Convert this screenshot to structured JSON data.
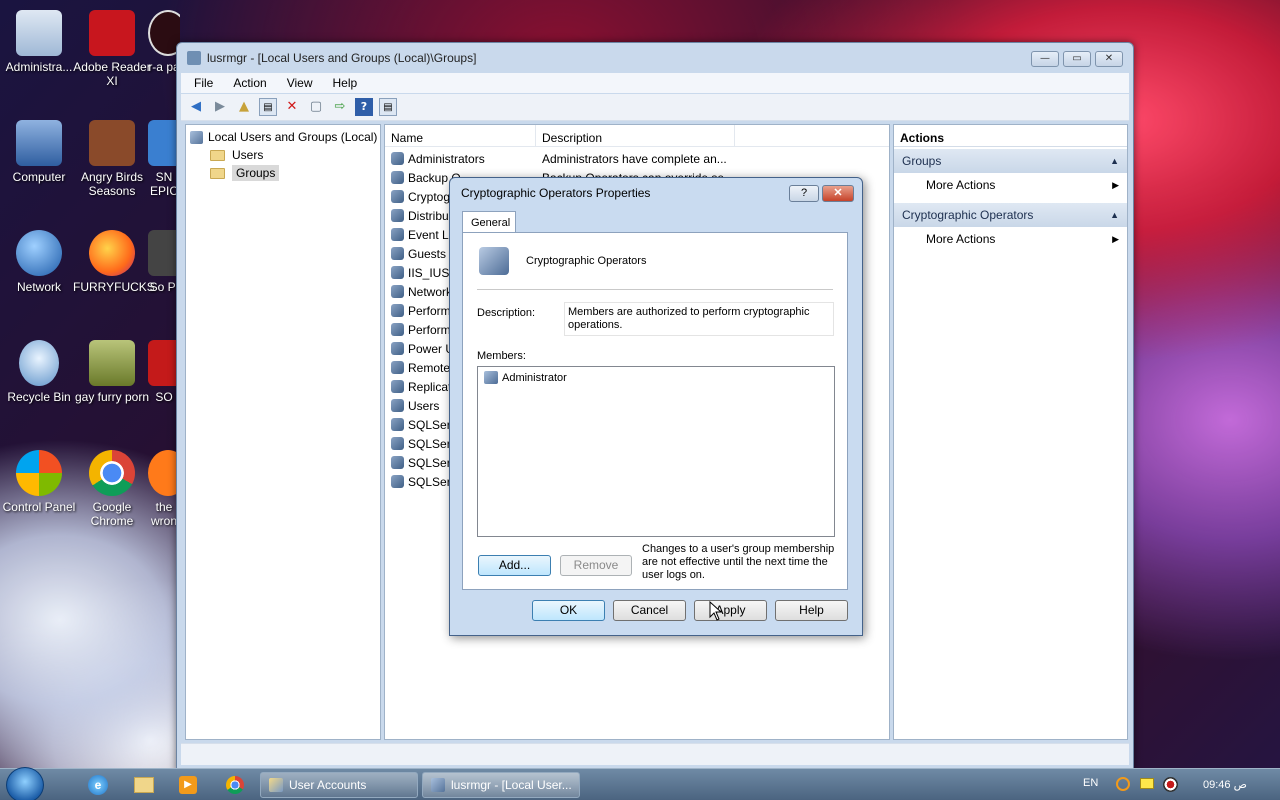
{
  "desktop": {
    "icons": [
      {
        "label": "Administra...",
        "color": "#9fb8d6"
      },
      {
        "label": "Adobe Reader XI",
        "color": "#c8161e"
      },
      {
        "label": "r-a pa",
        "color": "#2b0c12"
      },
      {
        "label": "Computer",
        "color": "#5d86c2"
      },
      {
        "label": "Angry Birds Seasons",
        "color": "#8a4a2a"
      },
      {
        "label": "SN EPIC",
        "color": "#3a7fd0"
      },
      {
        "label": "Network",
        "color": "#2c6cc0"
      },
      {
        "label": "FURRYFUCKS",
        "color": "#ff7a1a"
      },
      {
        "label": "So Pl",
        "color": "#444444"
      },
      {
        "label": "Recycle Bin",
        "color": "#8fb4d8"
      },
      {
        "label": "gay furry porn",
        "color": "#7a9a3a"
      },
      {
        "label": "SO",
        "color": "#c41a1a"
      },
      {
        "label": "Control Panel",
        "color": "#3b6fa8"
      },
      {
        "label": "Google Chrome",
        "color": "#e8b321"
      },
      {
        "label": "the wron",
        "color": "#ff7a1a"
      }
    ]
  },
  "window": {
    "title": "lusrmgr - [Local Users and Groups (Local)\\Groups]",
    "controls": {
      "minimize": "—",
      "maximize": "▭",
      "close": "✕"
    }
  },
  "menu": [
    "File",
    "Action",
    "View",
    "Help"
  ],
  "toolbar": {
    "icons": [
      "back-icon",
      "forward-icon",
      "up-icon",
      "show-hide-tree-icon",
      "delete-icon",
      "properties-icon",
      "export-icon",
      "help-icon",
      "show-hide-action-icon"
    ]
  },
  "tree": {
    "root": "Local Users and Groups (Local)",
    "children": [
      "Users",
      "Groups"
    ],
    "selected": "Groups"
  },
  "list": {
    "columns": [
      "Name",
      "Description"
    ],
    "rows": [
      {
        "name": "Administrators",
        "desc": "Administrators have complete an..."
      },
      {
        "name": "Backup O",
        "desc": "Backup Operators can override se..."
      },
      {
        "name": "Cryptog",
        "desc": ""
      },
      {
        "name": "Distribu",
        "desc": ""
      },
      {
        "name": "Event Lo",
        "desc": ""
      },
      {
        "name": "Guests",
        "desc": ""
      },
      {
        "name": "IIS_IUSR",
        "desc": ""
      },
      {
        "name": "Network",
        "desc": ""
      },
      {
        "name": "Perform",
        "desc": ""
      },
      {
        "name": "Perform",
        "desc": ""
      },
      {
        "name": "Power U",
        "desc": ""
      },
      {
        "name": "Remote",
        "desc": ""
      },
      {
        "name": "Replicat",
        "desc": ""
      },
      {
        "name": "Users",
        "desc": ""
      },
      {
        "name": "SQLServ",
        "desc": ""
      },
      {
        "name": "SQLServ",
        "desc": ""
      },
      {
        "name": "SQLServ",
        "desc": ""
      },
      {
        "name": "SQLServ",
        "desc": ""
      }
    ]
  },
  "actions": {
    "header": "Actions",
    "sections": [
      {
        "title": "Groups",
        "item": "More Actions"
      },
      {
        "title": "Cryptographic Operators",
        "item": "More Actions"
      }
    ]
  },
  "dialog": {
    "title": "Cryptographic Operators Properties",
    "help_btn": "?",
    "close_btn": "✕",
    "tab": "General",
    "group_name": "Cryptographic Operators",
    "description_label": "Description:",
    "description": "Members are authorized to perform cryptographic operations.",
    "members_label": "Members:",
    "members": [
      "Administrator"
    ],
    "add": "Add...",
    "remove": "Remove",
    "note": "Changes to a user's group membership are not effective until the next time the user logs on.",
    "ok": "OK",
    "cancel": "Cancel",
    "apply": "Apply",
    "help": "Help"
  },
  "taskbar": {
    "tasks": [
      {
        "label": "User Accounts"
      },
      {
        "label": "lusrmgr - [Local User..."
      }
    ],
    "lang": "EN",
    "time": "09:46 ص"
  }
}
